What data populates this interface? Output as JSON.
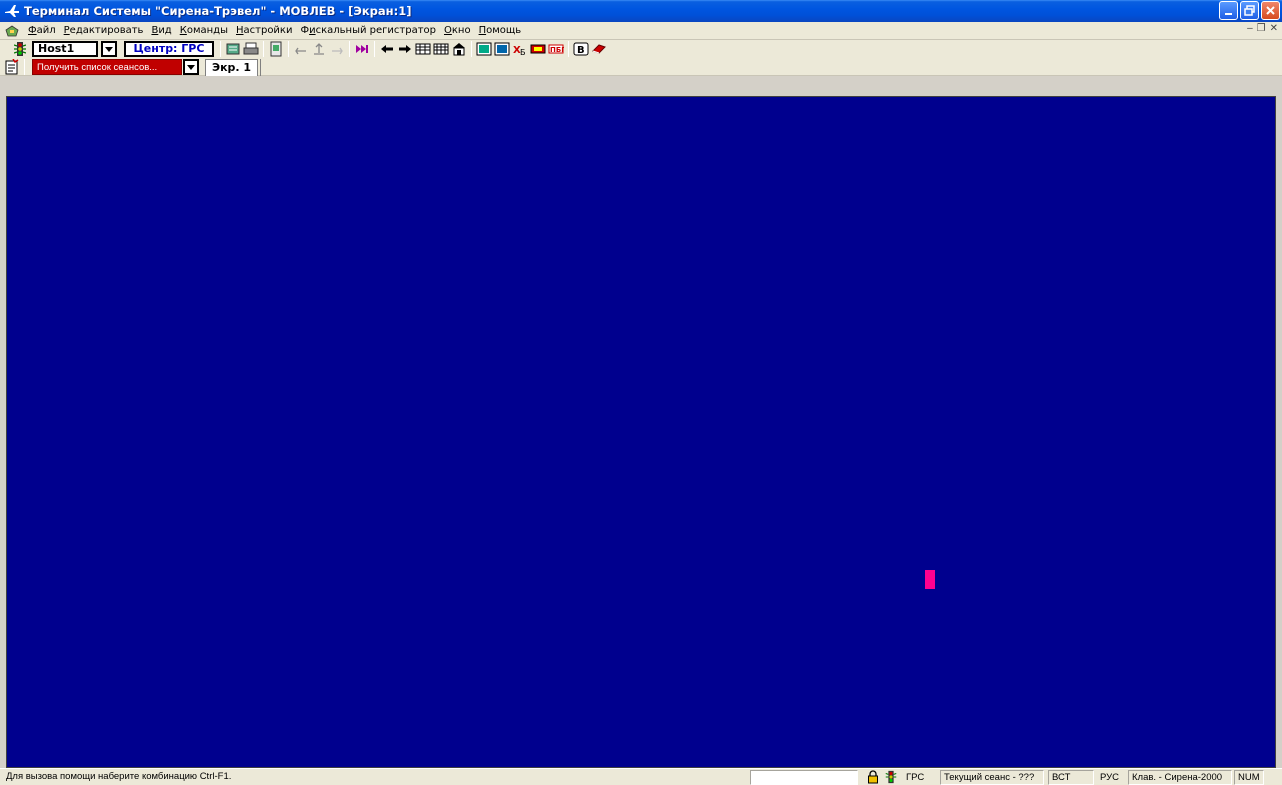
{
  "window": {
    "title": "Терминал Системы \"Сирена-Трэвел\" - МОВЛЕВ - [Экран:1]",
    "icon": "airplane-icon"
  },
  "menu": {
    "items": [
      {
        "label": "Файл",
        "key": "Ф",
        "rest": "айл"
      },
      {
        "label": "Редактировать",
        "key": "Р",
        "rest": "едактировать"
      },
      {
        "label": "Вид",
        "key": "В",
        "rest": "ид"
      },
      {
        "label": "Команды",
        "key": "К",
        "rest": "оманды"
      },
      {
        "label": "Настройки",
        "key": "Н",
        "rest": "астройки"
      },
      {
        "label": "Фискальный регистратор",
        "pre": "Ф",
        "key": "и",
        "rest": "скальный регистратор"
      },
      {
        "label": "Окно",
        "key": "О",
        "rest": "кно"
      },
      {
        "label": "Помощь",
        "key": "П",
        "rest": "омощь"
      }
    ],
    "mdi": [
      "–",
      "❐",
      "✕"
    ]
  },
  "toolbar": {
    "host_value": "Host1",
    "center_label": "Центр: ГРС",
    "session_label": "Получить список сеансов...",
    "screen_tab": "Экр. 1"
  },
  "statusbar": {
    "help": "Для вызова помощи наберите комбинацию Ctrl-F1.",
    "center": "ГРС",
    "session": "Текущий сеанс - ???",
    "insert": "ВСТ",
    "lang": "РУС",
    "keyboard": "Клав. - Сирена-2000",
    "num": "NUM"
  },
  "colors": {
    "terminal_bg": "#00008e",
    "cursor": "#ff0090",
    "session_bg": "#c00000"
  }
}
